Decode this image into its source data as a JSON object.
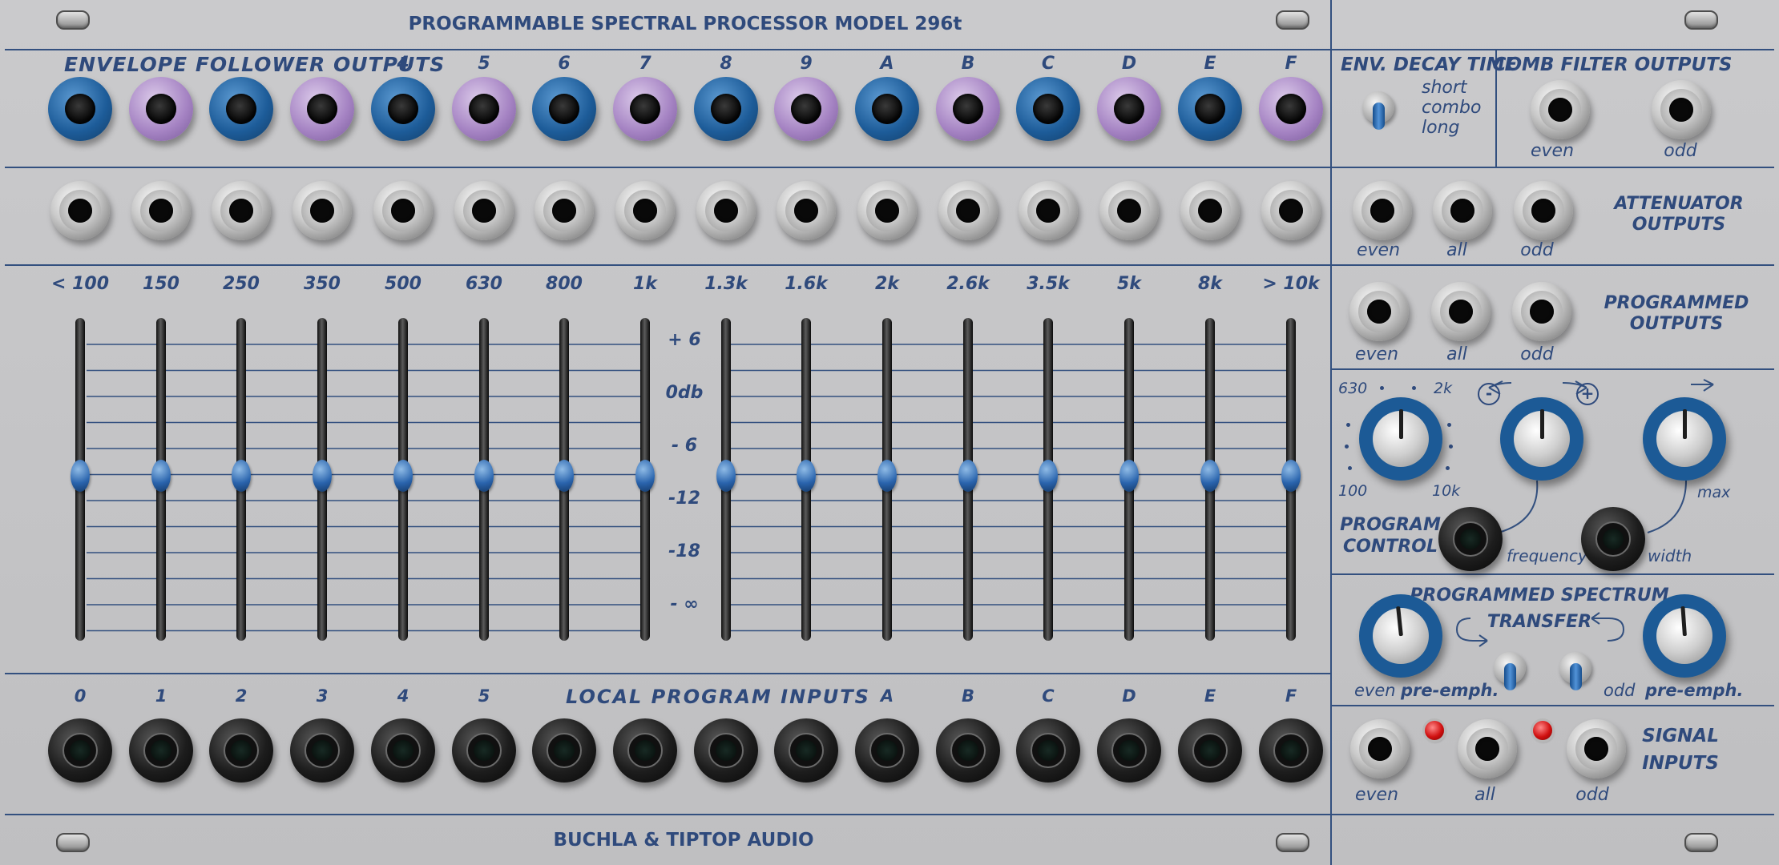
{
  "header": {
    "title": "PROGRAMMABLE SPECTRAL PROCESSOR MODEL 296t",
    "footer": "BUCHLA & TIPTOP AUDIO"
  },
  "envelope_outputs": {
    "section_label": "ENVELOPE FOLLOWER OUTPUTS",
    "channel_labels": [
      "4",
      "5",
      "6",
      "7",
      "8",
      "9",
      "A",
      "B",
      "C",
      "D",
      "E",
      "F"
    ],
    "jack_colors": [
      "blue",
      "violet",
      "blue",
      "violet",
      "blue",
      "violet",
      "blue",
      "violet",
      "blue",
      "violet",
      "blue",
      "violet",
      "blue",
      "violet",
      "blue",
      "violet"
    ]
  },
  "band_labels": [
    "< 100",
    "150",
    "250",
    "350",
    "500",
    "630",
    "800",
    "1k",
    "1.3k",
    "1.6k",
    "2k",
    "2.6k",
    "3.5k",
    "5k",
    "8k",
    "> 10k"
  ],
  "db_scale": [
    "+ 6",
    "0db",
    "- 6",
    "-12",
    "-18",
    "- ∞"
  ],
  "slider_levels": [
    0.5,
    0.5,
    0.5,
    0.5,
    0.5,
    0.5,
    0.5,
    0.5,
    0.5,
    0.5,
    0.5,
    0.5,
    0.5,
    0.5,
    0.5,
    0.5
  ],
  "local_program_inputs": {
    "section_label": "LOCAL PROGRAM INPUTS",
    "labels_left": [
      "0",
      "1",
      "2",
      "3",
      "4",
      "5"
    ],
    "labels_right": [
      "A",
      "B",
      "C",
      "D",
      "E",
      "F"
    ]
  },
  "env_decay": {
    "title": "ENV. DECAY TIME",
    "options": [
      "short",
      "combo",
      "long"
    ]
  },
  "comb_filter": {
    "title": "COMB FILTER OUTPUTS",
    "even": "even",
    "odd": "odd"
  },
  "attenuator": {
    "title_line1": "ATTENUATOR",
    "title_line2": "OUTPUTS",
    "even": "even",
    "all": "all",
    "odd": "odd"
  },
  "programmed": {
    "title_line1": "PROGRAMMED",
    "title_line2": "OUTPUTS",
    "even": "even",
    "all": "all",
    "odd": "odd"
  },
  "program_control": {
    "label_line1": "PROGRAM",
    "label_line2": "CONTROL",
    "freq_630": "630",
    "freq_2k": "2k",
    "freq_100": "100",
    "freq_10k": "10k",
    "minus": "-",
    "plus": "+",
    "frequency": "frequency",
    "width": "width",
    "max": "max"
  },
  "spectrum_transfer": {
    "title_line1": "PROGRAMMED SPECTRUM",
    "title_line2": "TRANSFER",
    "even_label": "even",
    "even_pre": "pre-emph.",
    "odd_label": "odd",
    "odd_pre": "pre-emph."
  },
  "signal_inputs": {
    "title_line1": "SIGNAL",
    "title_line2": "INPUTS",
    "even": "even",
    "all": "all",
    "odd": "odd"
  },
  "colors": {
    "panel": "#c4c4c6",
    "ink": "#2f4a7c",
    "jack_blue": "#1d5c99",
    "jack_violet": "#a583c3",
    "led": "#d01010"
  }
}
